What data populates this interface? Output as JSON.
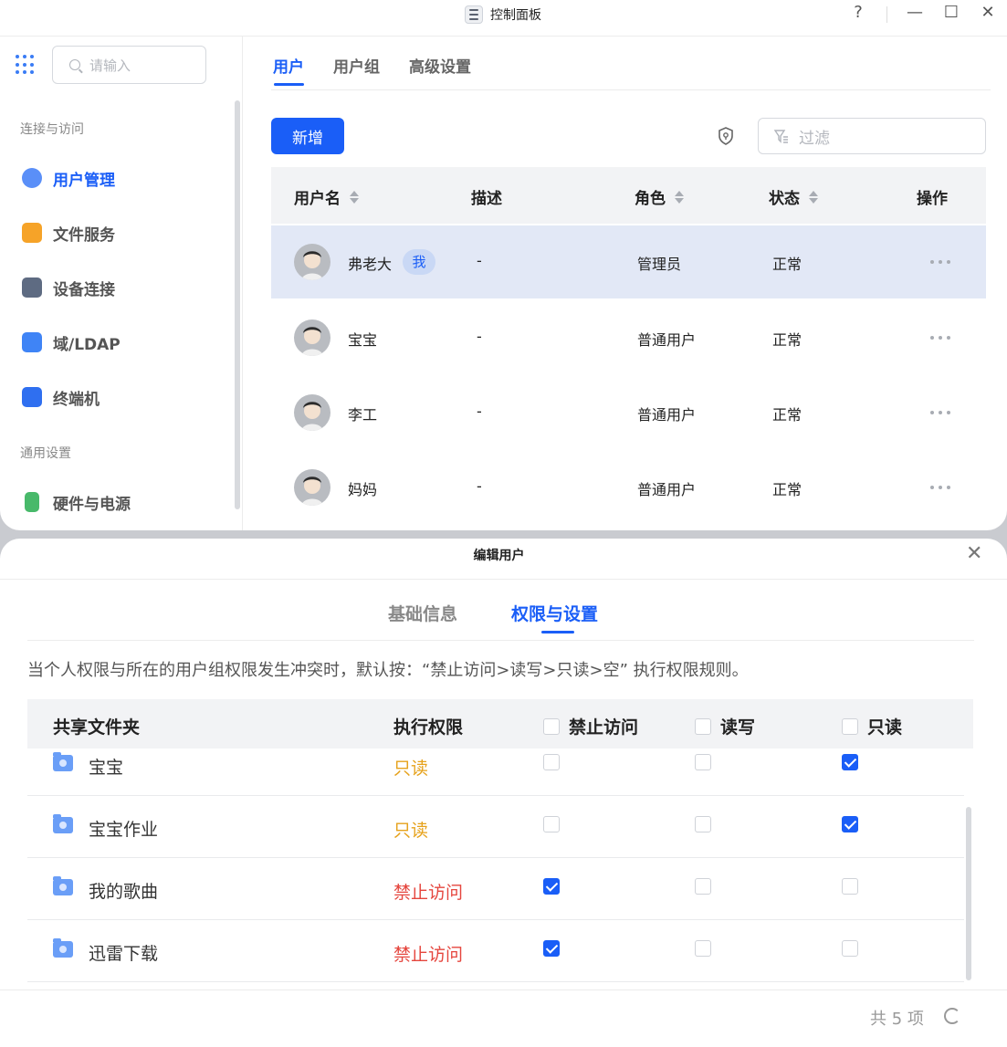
{
  "window": {
    "title": "控制面板",
    "help": "?",
    "minimize": "—",
    "maximize": "☐",
    "close": "✕"
  },
  "sidebar": {
    "search_placeholder": "请输入",
    "groups": [
      "连接与访问",
      "通用设置"
    ],
    "items": [
      {
        "label": "用户管理",
        "icon": "users-icon",
        "active": true
      },
      {
        "label": "文件服务",
        "icon": "folder-icon"
      },
      {
        "label": "设备连接",
        "icon": "device-icon"
      },
      {
        "label": "域/LDAP",
        "icon": "ldap-icon"
      },
      {
        "label": "终端机",
        "icon": "terminal-icon"
      },
      {
        "label": "硬件与电源",
        "icon": "battery-icon"
      }
    ]
  },
  "main": {
    "tabs": [
      {
        "label": "用户",
        "active": true
      },
      {
        "label": "用户组"
      },
      {
        "label": "高级设置"
      }
    ],
    "add_button": "新增",
    "filter_placeholder": "过滤",
    "columns": [
      "用户名",
      "描述",
      "角色",
      "状态",
      "操作"
    ],
    "rows": [
      {
        "name": "弗老大",
        "badge": "我",
        "desc": "-",
        "role": "管理员",
        "status": "正常",
        "selected": true
      },
      {
        "name": "宝宝",
        "desc": "-",
        "role": "普通用户",
        "status": "正常"
      },
      {
        "name": "李工",
        "desc": "-",
        "role": "普通用户",
        "status": "正常"
      },
      {
        "name": "妈妈",
        "desc": "-",
        "role": "普通用户",
        "status": "正常"
      }
    ]
  },
  "dialog": {
    "title": "编辑用户",
    "close": "✕",
    "tabs": [
      {
        "label": "基础信息"
      },
      {
        "label": "权限与设置",
        "active": true
      }
    ],
    "notice": "当个人权限与所在的用户组权限发生冲突时，默认按：“禁止访问>读写>只读>空” 执行权限规则。",
    "columns": {
      "folder": "共享文件夹",
      "permission": "执行权限",
      "deny": "禁止访问",
      "rw": "读写",
      "ro": "只读"
    },
    "rows": [
      {
        "folder": "宝宝",
        "permission": "只读",
        "kind": "ro",
        "deny": false,
        "rw": false,
        "ro": true
      },
      {
        "folder": "宝宝作业",
        "permission": "只读",
        "kind": "ro",
        "deny": false,
        "rw": false,
        "ro": true
      },
      {
        "folder": "我的歌曲",
        "permission": "禁止访问",
        "kind": "deny",
        "deny": true,
        "rw": false,
        "ro": false
      },
      {
        "folder": "迅雷下载",
        "permission": "禁止访问",
        "kind": "deny",
        "deny": true,
        "rw": false,
        "ro": false
      }
    ],
    "total": "共 5 项"
  },
  "colors": {
    "accent": "#1a5ef7",
    "readonly": "#e6a21c",
    "deny": "#e5463e",
    "selected_row": "#e2e8f6"
  }
}
